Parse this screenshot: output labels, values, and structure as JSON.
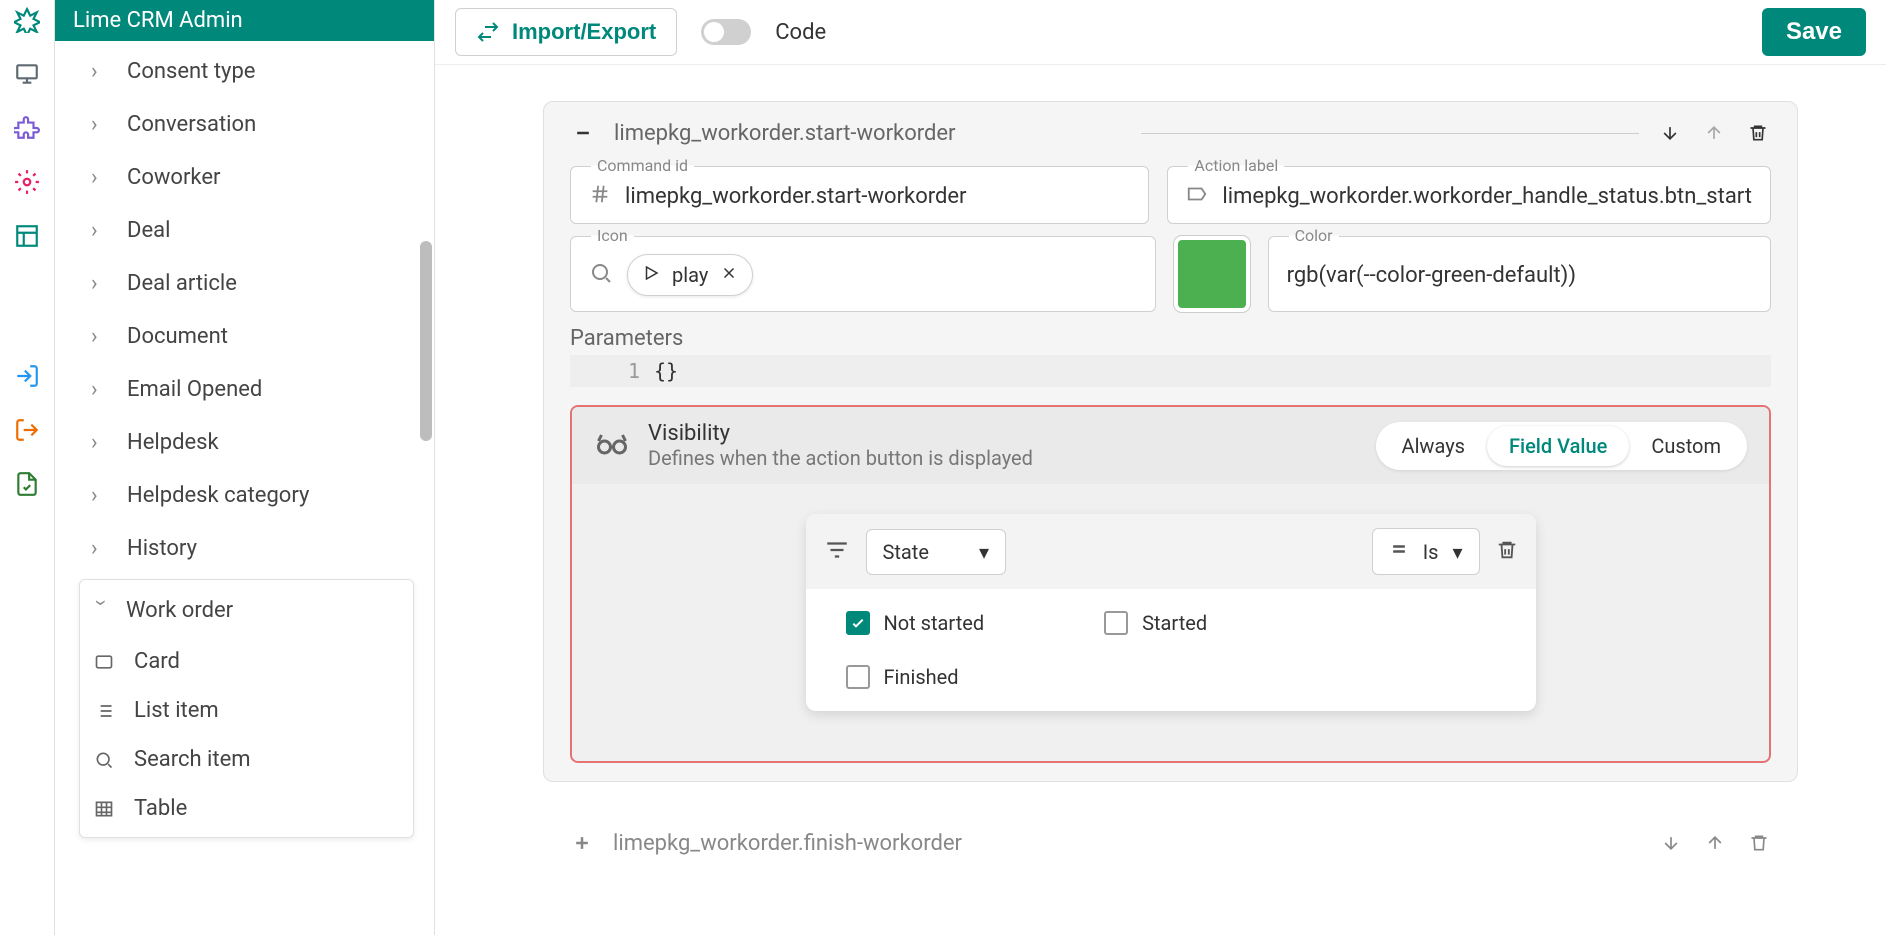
{
  "app_title": "Lime CRM Admin",
  "rail_icons": [
    "design",
    "monitor",
    "puzzle",
    "gear",
    "layout",
    "login",
    "logout",
    "file-check"
  ],
  "rail_colors": [
    "#00897b",
    "#5f6a72",
    "#7b5cd6",
    "#e91e63",
    "#00897b",
    "#2196f3",
    "#ef6c00",
    "#2e7d32"
  ],
  "sidebar": {
    "items": [
      {
        "label": "Consent type"
      },
      {
        "label": "Conversation"
      },
      {
        "label": "Coworker"
      },
      {
        "label": "Deal"
      },
      {
        "label": "Deal article"
      },
      {
        "label": "Document"
      },
      {
        "label": "Email Opened"
      },
      {
        "label": "Helpdesk"
      },
      {
        "label": "Helpdesk category"
      },
      {
        "label": "History"
      }
    ],
    "expanded": {
      "label": "Work order",
      "subitems": [
        {
          "icon": "card",
          "label": "Card"
        },
        {
          "icon": "list",
          "label": "List item"
        },
        {
          "icon": "search",
          "label": "Search item"
        },
        {
          "icon": "table",
          "label": "Table"
        }
      ]
    }
  },
  "toolbar": {
    "import_export": "Import/Export",
    "code_label": "Code",
    "save": "Save"
  },
  "action": {
    "title": "limepkg_workorder.start-workorder",
    "command_id_label": "Command id",
    "command_id": "limepkg_workorder.start-workorder",
    "action_label_label": "Action label",
    "action_label": "limepkg_workorder.workorder_handle_status.btn_start",
    "icon_label": "Icon",
    "icon_value": "play",
    "color_label": "Color",
    "color_value": "rgb(var(--color-green-default))",
    "color_swatch": "#4caf50",
    "params_label": "Parameters",
    "params_line_num": "1",
    "params_code": "{}"
  },
  "visibility": {
    "title": "Visibility",
    "subtitle": "Defines when the action button is displayed",
    "tabs": [
      "Always",
      "Field Value",
      "Custom"
    ],
    "active_tab": "Field Value",
    "rule": {
      "field": "State",
      "operator": "Is",
      "options": [
        {
          "label": "Not started",
          "checked": true
        },
        {
          "label": "Started",
          "checked": false
        },
        {
          "label": "Finished",
          "checked": false
        }
      ]
    }
  },
  "next_action_title": "limepkg_workorder.finish-workorder"
}
